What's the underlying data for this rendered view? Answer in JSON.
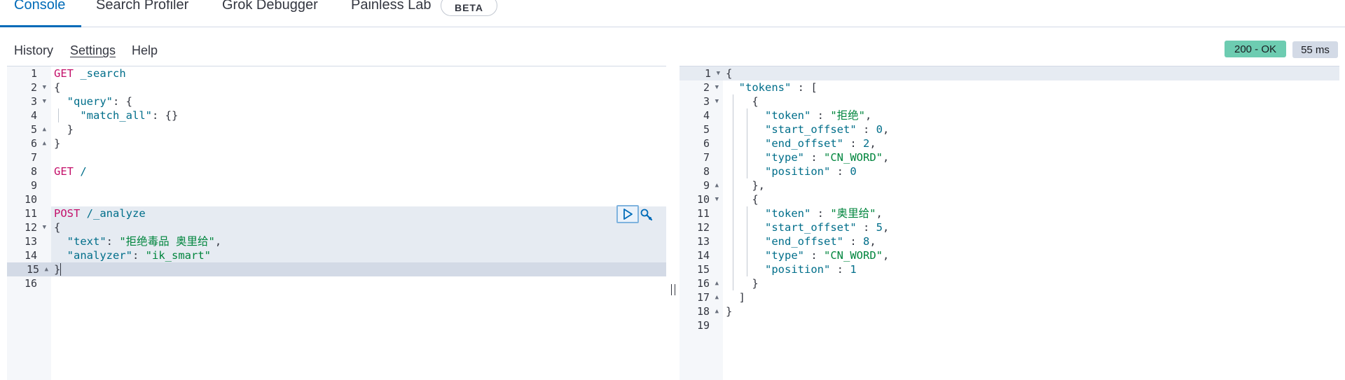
{
  "tabs": [
    {
      "label": "Console"
    },
    {
      "label": "Search Profiler"
    },
    {
      "label": "Grok Debugger"
    },
    {
      "label": "Painless Lab"
    }
  ],
  "beta_label": "BETA",
  "menu": [
    {
      "label": "History"
    },
    {
      "label": "Settings"
    },
    {
      "label": "Help"
    }
  ],
  "status": {
    "code": "200 - OK",
    "time": "55 ms"
  },
  "request": {
    "line_numbers": [
      "1",
      "2",
      "3",
      "4",
      "5",
      "6",
      "7",
      "8",
      "9",
      "10",
      "11",
      "12",
      "13",
      "14",
      "15",
      "16"
    ],
    "lines": [
      [
        "GET",
        "_search"
      ],
      [
        "{"
      ],
      [
        "\"query\"",
        ": {"
      ],
      [
        "\"match_all\"",
        ": {}"
      ],
      [
        "}"
      ],
      [
        "}"
      ],
      [],
      [
        "GET",
        "/"
      ],
      [],
      [],
      [
        "POST",
        "/_analyze"
      ],
      [
        "{"
      ],
      [
        "\"text\"",
        ": ",
        "\"拒绝毒品 奥里给\"",
        ","
      ],
      [
        "\"analyzer\"",
        ": ",
        "\"ik_smart\""
      ],
      [
        "}"
      ],
      []
    ]
  },
  "response": {
    "line_numbers": [
      "1",
      "2",
      "3",
      "4",
      "5",
      "6",
      "7",
      "8",
      "9",
      "10",
      "11",
      "12",
      "13",
      "14",
      "15",
      "16",
      "17",
      "18",
      "19"
    ],
    "lines": [
      [
        "{"
      ],
      [
        "\"tokens\"",
        " : ["
      ],
      [
        "{"
      ],
      [
        "\"token\"",
        " : ",
        "\"拒绝\"",
        ","
      ],
      [
        "\"start_offset\"",
        " : ",
        "0",
        ","
      ],
      [
        "\"end_offset\"",
        " : ",
        "2",
        ","
      ],
      [
        "\"type\"",
        " : ",
        "\"CN_WORD\"",
        ","
      ],
      [
        "\"position\"",
        " : ",
        "0"
      ],
      [
        "},"
      ],
      [
        "{"
      ],
      [
        "\"token\"",
        " : ",
        "\"奥里给\"",
        ","
      ],
      [
        "\"start_offset\"",
        " : ",
        "5",
        ","
      ],
      [
        "\"end_offset\"",
        " : ",
        "8",
        ","
      ],
      [
        "\"type\"",
        " : ",
        "\"CN_WORD\"",
        ","
      ],
      [
        "\"position\"",
        " : ",
        "1"
      ],
      [
        "}"
      ],
      [
        "]"
      ],
      [
        "}"
      ],
      []
    ]
  },
  "colors": {
    "accent": "#006bb8",
    "status_ok": "#6dccb1",
    "method": "#c3106a",
    "string": "#00853d",
    "key": "#006e8a"
  }
}
